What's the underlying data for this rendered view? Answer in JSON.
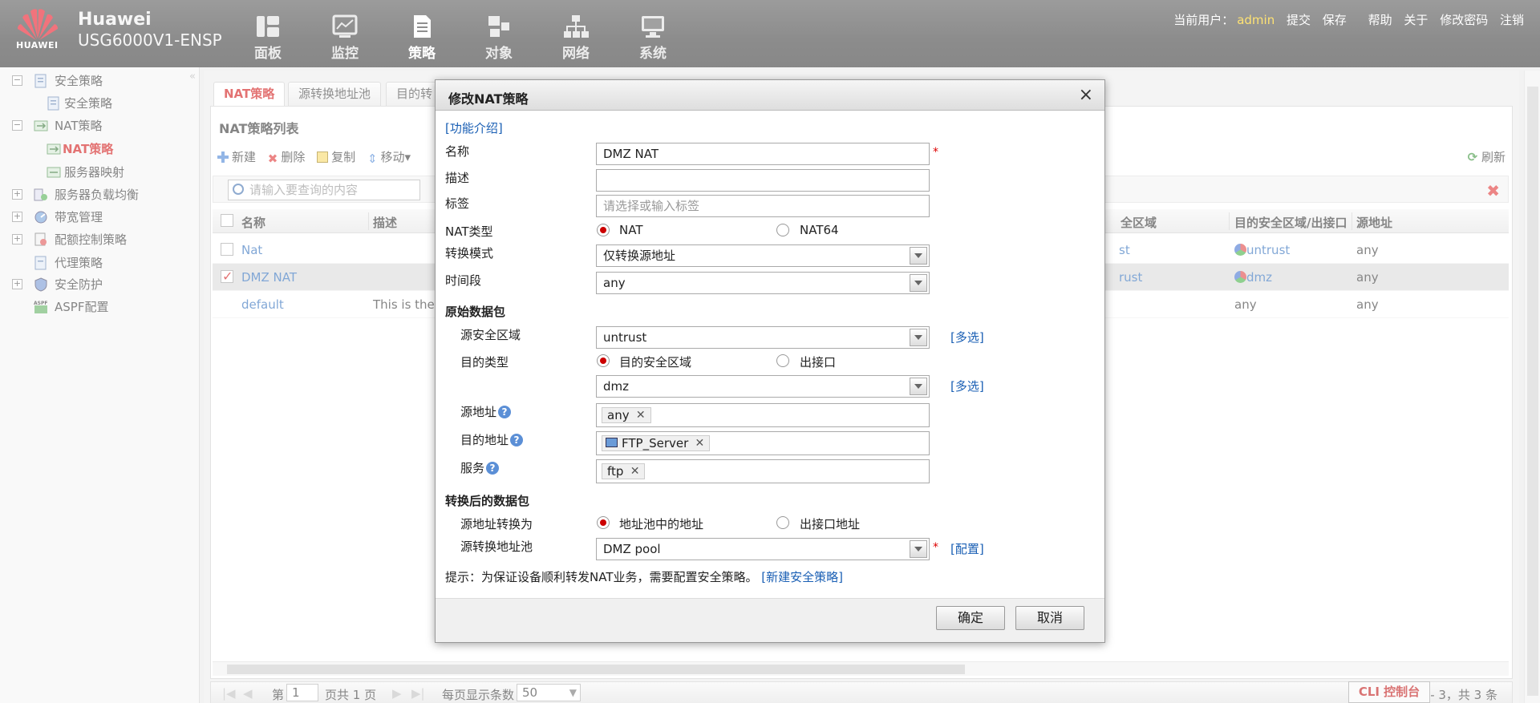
{
  "header": {
    "brand": "Huawei",
    "model": "USG6000V1-ENSP",
    "logo_text": "HUAWEI",
    "nav": [
      "面板",
      "监控",
      "策略",
      "对象",
      "网络",
      "系统"
    ],
    "user_label": "当前用户：",
    "username": "admin",
    "actions": [
      "提交",
      "保存",
      "帮助",
      "关于",
      "修改密码",
      "注销"
    ]
  },
  "sidebar": {
    "items": [
      {
        "label": "安全策略",
        "expander": "−"
      },
      {
        "label": "安全策略"
      },
      {
        "label": "NAT策略",
        "expander": "−"
      },
      {
        "label": "NAT策略"
      },
      {
        "label": "服务器映射"
      },
      {
        "label": "服务器负载均衡",
        "expander": "+"
      },
      {
        "label": "带宽管理",
        "expander": "+"
      },
      {
        "label": "配额控制策略",
        "expander": "+"
      },
      {
        "label": "代理策略"
      },
      {
        "label": "安全防护",
        "expander": "+"
      },
      {
        "label": "ASPF配置"
      }
    ],
    "collapse_glyph": "«"
  },
  "tabs": [
    "NAT策略",
    "源转换地址池",
    "目的转"
  ],
  "panel": {
    "title": "NAT策略列表",
    "toolbar": [
      "新建",
      "删除",
      "复制",
      "移动▾"
    ],
    "refresh": "刷新",
    "search_placeholder": "请输入要查询的内容",
    "columns": [
      "名称",
      "描述",
      "全区域",
      "目的安全区域/出接口",
      "源地址"
    ],
    "rows": [
      {
        "name": "Nat",
        "desc": "",
        "src_zone": "st",
        "dst_zone": "untrust",
        "src_addr": "any",
        "checked": false
      },
      {
        "name": "DMZ NAT",
        "desc": "",
        "src_zone": "rust",
        "dst_zone": "dmz",
        "src_addr": "any",
        "checked": true
      },
      {
        "name": "default",
        "desc": "This is the d",
        "src_zone": "",
        "dst_zone": "any",
        "src_addr": "any",
        "checked": false
      }
    ],
    "pager": {
      "page_prefix": "第",
      "page": "1",
      "page_suffix": "页共 1 页",
      "per_page_label": "每页显示条数",
      "per_page": "50",
      "summary": "显示 1 - 3，共 3 条"
    }
  },
  "cli": "CLI 控制台",
  "dialog": {
    "title": "修改NAT策略",
    "close": "×",
    "intro_link": "[功能介绍]",
    "labels": {
      "name": "名称",
      "desc": "描述",
      "tag": "标签",
      "nat_type": "NAT类型",
      "mode": "转换模式",
      "time": "时间段",
      "orig_section": "原始数据包",
      "src_zone": "源安全区域",
      "dst_type": "目的类型",
      "src_addr": "源地址",
      "dst_addr": "目的地址",
      "service": "服务",
      "post_section": "转换后的数据包",
      "src_translate": "源地址转换为",
      "pool": "源转换地址池"
    },
    "values": {
      "name": "DMZ NAT",
      "desc": "",
      "tag_placeholder": "请选择或输入标签",
      "nat_type_opts": [
        "NAT",
        "NAT64"
      ],
      "mode": "仅转换源地址",
      "time": "any",
      "src_zone": "untrust",
      "dst_type_opts": [
        "目的安全区域",
        "出接口"
      ],
      "dst_zone": "dmz",
      "src_addr_tag": "any",
      "dst_addr_tag": "FTP_Server",
      "service_tag": "ftp",
      "translate_opts": [
        "地址池中的地址",
        "出接口地址"
      ],
      "pool": "DMZ pool"
    },
    "multi": "[多选]",
    "config": "[配置]",
    "hint": "提示：为保证设备顺利转发NAT业务，需要配置安全策略。",
    "hint_link": "[新建安全策略]",
    "ok": "确定",
    "cancel": "取消"
  },
  "colors": {
    "accent": "#cc0000",
    "link": "#1a5fb4",
    "user": "#ffcc00"
  }
}
